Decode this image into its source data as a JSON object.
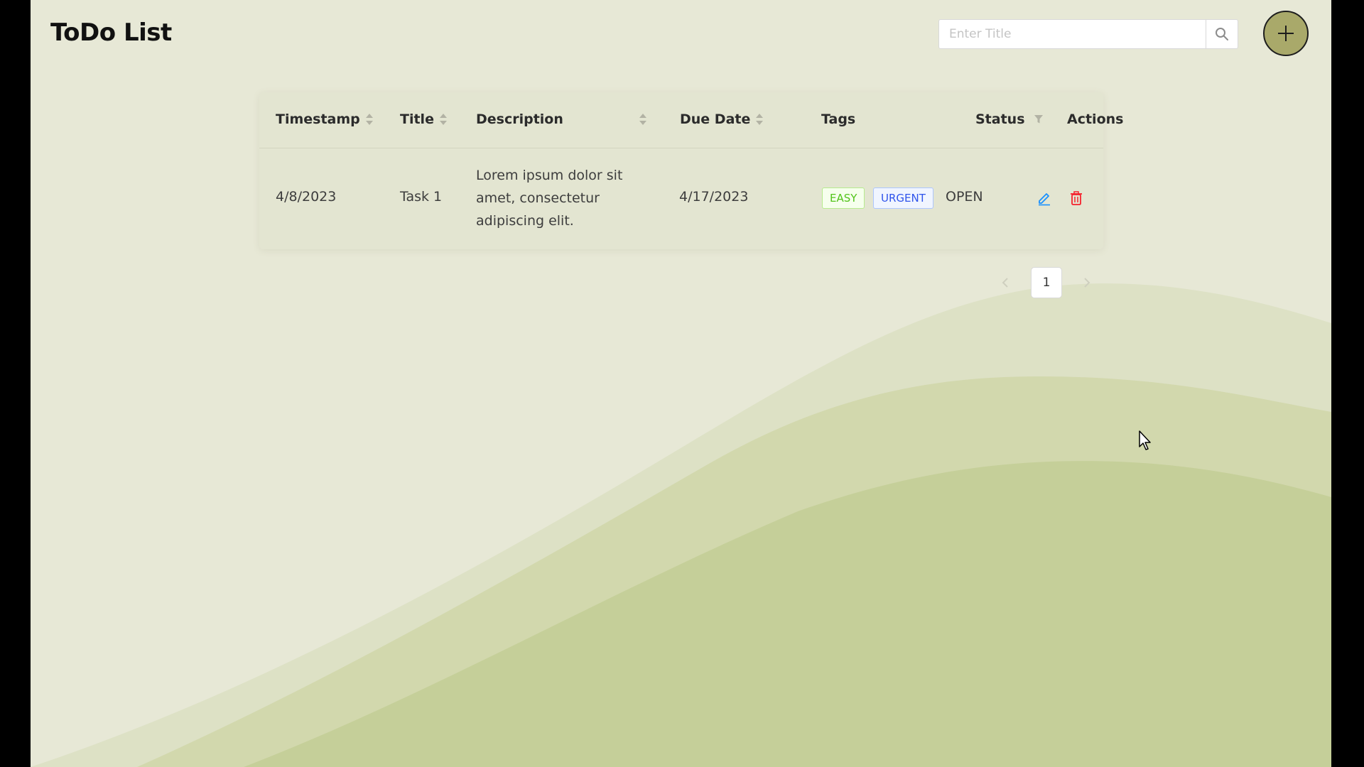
{
  "app": {
    "title": "ToDo List"
  },
  "search": {
    "placeholder": "Enter Title",
    "icon": "search-icon"
  },
  "add_button": {
    "icon": "plus-icon"
  },
  "table": {
    "columns": [
      {
        "label": "Timestamp",
        "sortable": true
      },
      {
        "label": "Title",
        "sortable": true
      },
      {
        "label": "Description",
        "sortable": true
      },
      {
        "label": "Due Date",
        "sortable": true
      },
      {
        "label": "Tags",
        "sortable": false
      },
      {
        "label": "Status",
        "filterable": true
      },
      {
        "label": "Actions",
        "sortable": false
      }
    ],
    "rows": [
      {
        "timestamp": "4/8/2023",
        "title": "Task 1",
        "description": "Lorem ipsum dolor sit amet, consectetur adipiscing elit.",
        "due_date": "4/17/2023",
        "tags": [
          "EASY",
          "URGENT"
        ],
        "status": "OPEN",
        "actions": [
          "edit-icon",
          "delete-icon"
        ]
      }
    ]
  },
  "pagination": {
    "current_page": "1"
  },
  "colors": {
    "background": "#e7e8d6",
    "hill_mid": "#d4d9b4",
    "hill_dark": "#c3cd96",
    "add_button": "#a9a96a",
    "tag_easy": "#52c41a",
    "tag_urgent": "#2f54eb",
    "edit_icon": "#1890ff",
    "delete_icon": "#f5222d"
  }
}
